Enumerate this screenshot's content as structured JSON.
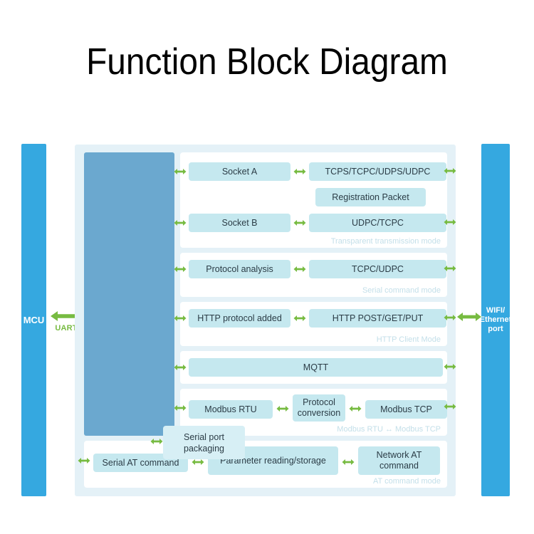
{
  "title": "Function Block Diagram",
  "colors": {
    "side_bar": "#35a8e0",
    "column": "#6ba8cf",
    "block": "#c5e8ef",
    "container": "#e4f1f7",
    "panel": "#ffffff",
    "arrow": "#77bb41",
    "mode_label": "#c3dfe9",
    "text": "#2b3c46"
  },
  "left_port": {
    "label": "MCU",
    "link_label": "UART"
  },
  "right_port": {
    "label": "WIFI/\nEthernet\nport"
  },
  "column": {
    "serial_port_block": "Serial port\npackaging"
  },
  "panels": [
    {
      "name": "transparent-transmission",
      "mode_label": "Transparent transmission mode",
      "rows": [
        {
          "blocks": [
            "Socket A",
            "TCPS/TCPC/UDPS/UDPC"
          ]
        },
        {
          "blocks": [
            "Registration Packet"
          ]
        },
        {
          "blocks": [
            "Socket B",
            "UDPC/TCPC"
          ]
        }
      ]
    },
    {
      "name": "serial-command",
      "mode_label": "Serial command mode",
      "rows": [
        {
          "blocks": [
            "Protocol analysis",
            "TCPC/UDPC"
          ]
        }
      ]
    },
    {
      "name": "http-client",
      "mode_label": "HTTP Client Mode",
      "rows": [
        {
          "blocks": [
            "HTTP protocol added",
            "HTTP POST/GET/PUT"
          ]
        }
      ]
    },
    {
      "name": "mqtt",
      "mode_label": "",
      "rows": [
        {
          "blocks": [
            "MQTT"
          ]
        }
      ]
    },
    {
      "name": "modbus",
      "mode_label": "Modbus RTU ↔ Modbus TCP",
      "rows": [
        {
          "blocks": [
            "Modbus RTU",
            "Protocol\nconversion",
            "Modbus TCP"
          ]
        }
      ]
    },
    {
      "name": "at-command",
      "mode_label": "AT command mode",
      "rows": [
        {
          "blocks": [
            "Serial AT command",
            "Parameter reading/storage",
            "Network AT\ncommand"
          ]
        }
      ]
    }
  ],
  "blocks": {
    "socket_a": "Socket A",
    "tcps_group": "TCPS/TCPC/UDPS/UDPC",
    "registration_packet": "Registration Packet",
    "socket_b": "Socket B",
    "udpc_tcpc": "UDPC/TCPC",
    "transparent_mode": "Transparent transmission mode",
    "protocol_analysis": "Protocol analysis",
    "tcpc_udpc": "TCPC/UDPC",
    "serial_command_mode": "Serial command mode",
    "http_protocol_added": "HTTP protocol added",
    "http_methods": "HTTP POST/GET/PUT",
    "http_client_mode": "HTTP Client Mode",
    "mqtt": "MQTT",
    "modbus_rtu": "Modbus RTU",
    "protocol_conversion": "Protocol\nconversion",
    "modbus_tcp": "Modbus TCP",
    "modbus_mode": "Modbus RTU ↔ Modbus TCP",
    "serial_at_command": "Serial AT command",
    "parameter_reading": "Parameter reading/storage",
    "network_at_command": "Network AT\ncommand",
    "at_command_mode": "AT command mode"
  }
}
